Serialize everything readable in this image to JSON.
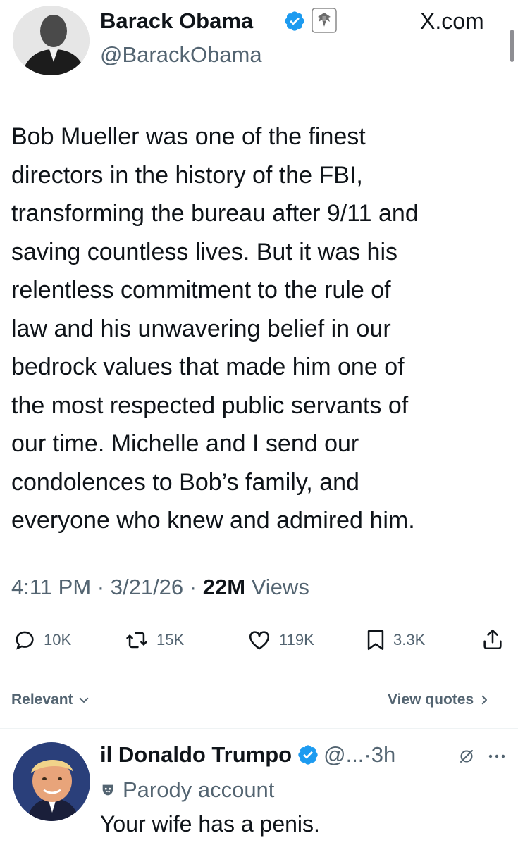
{
  "site_label": "X.com",
  "tweet": {
    "author": {
      "name": "Barack Obama",
      "handle": "@BarackObama"
    },
    "lines": [
      "Bob Mueller was one of the finest",
      "directors in the history of the FBI,",
      "transforming the bureau after 9/11 and",
      "saving countless lives. But it was his",
      "relentless commitment to the rule of",
      "law and his unwavering belief in our",
      "bedrock values that made him one of",
      "the most respected public servants of",
      "our time. Michelle and I send our",
      "condolences to Bob’s family, and",
      "everyone who knew and admired him."
    ],
    "time": "4:11 PM",
    "date": "3/21/26",
    "separator": "·",
    "views_count": "22M",
    "views_label": "Views",
    "actions": {
      "replies": "10K",
      "reposts": "15K",
      "likes": "119K",
      "bookmarks": "3.3K"
    }
  },
  "sort": {
    "label": "Relevant",
    "view_quotes": "View quotes"
  },
  "reply": {
    "author": {
      "name": "il Donaldo Trumpo",
      "handle": "@...",
      "time": "3h"
    },
    "parody_label": "Parody account",
    "text": "Your wife has a penis."
  },
  "colors": {
    "verified": "#1d9bf0",
    "text_primary": "#0f1419",
    "text_secondary": "#536471",
    "divider": "#eff3f4"
  },
  "icons": [
    "verified-badge-icon",
    "government-seal-icon",
    "reply-icon",
    "repost-icon",
    "like-icon",
    "bookmark-icon",
    "share-icon",
    "chevron-down-icon",
    "chevron-right-icon",
    "parody-mask-icon",
    "grok-icon",
    "more-icon"
  ]
}
